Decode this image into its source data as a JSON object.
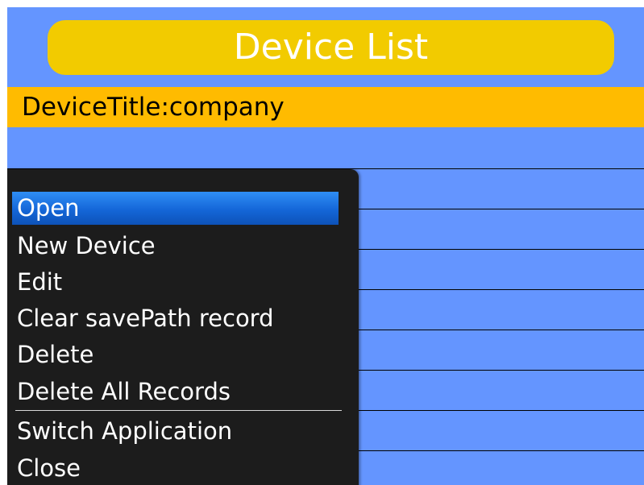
{
  "header": {
    "title": "Device List"
  },
  "list": {
    "selected_item": "DeviceTitle:company",
    "empty_row_count": 8
  },
  "menu": {
    "items": [
      {
        "label": "Open",
        "highlighted": true
      },
      {
        "label": "New Device",
        "highlighted": false
      },
      {
        "label": "Edit",
        "highlighted": false
      },
      {
        "label": "Clear savePath record",
        "highlighted": false
      },
      {
        "label": "Delete",
        "highlighted": false
      },
      {
        "label": "Delete All Records",
        "highlighted": false
      },
      {
        "label": "Switch Application",
        "highlighted": false
      },
      {
        "label": "Close",
        "highlighted": false
      }
    ]
  },
  "colors": {
    "background": "#6495ff",
    "title_bar": "#f2cb00",
    "selected_row": "#ffbb00",
    "menu_background": "#1c1c1c",
    "menu_highlight": "#1466d8"
  }
}
